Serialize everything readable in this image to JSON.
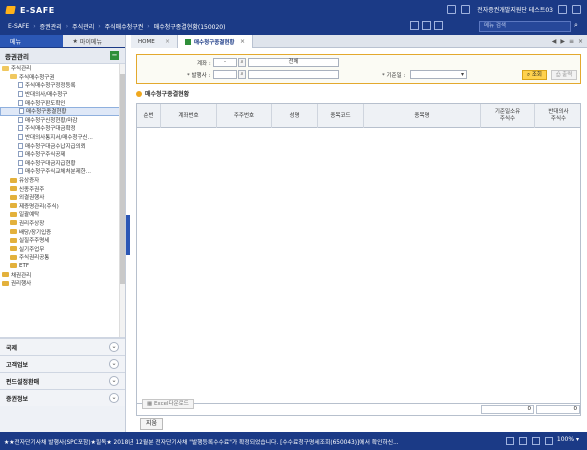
{
  "app": {
    "logo_text": "E-SAFE",
    "user": "전자증권개발지원단 테스트03"
  },
  "breadcrumb": [
    "E-SAFE",
    "증권관리",
    "주식관리",
    "주식매수청구권",
    "매수청구종결현황(150020)"
  ],
  "header": {
    "search_placeholder": "메뉴 검색"
  },
  "left_panel": {
    "tabs": [
      {
        "label": "메뉴"
      },
      {
        "label": "마이메뉴"
      }
    ],
    "section": "증권관리",
    "tree": [
      {
        "label": "주식관리",
        "type": "folder-open",
        "level": 1
      },
      {
        "label": "주식매수청구권",
        "type": "folder-open",
        "level": 2
      },
      {
        "label": "주식매수청구정정등록",
        "type": "doc",
        "level": 3
      },
      {
        "label": "반대의사/매수청구",
        "type": "doc",
        "level": 3
      },
      {
        "label": "매수청구판도확인",
        "type": "doc",
        "level": 3
      },
      {
        "label": "매수청구종결현황",
        "type": "doc",
        "level": 3,
        "selected": true
      },
      {
        "label": "매수청구신청현황/마감",
        "type": "doc",
        "level": 3
      },
      {
        "label": "주식매수청구대금확정",
        "type": "doc",
        "level": 3
      },
      {
        "label": "반대의사통지서/매수청구신...",
        "type": "doc",
        "level": 3
      },
      {
        "label": "매수청구대금수납지급의뢰",
        "type": "doc",
        "level": 3
      },
      {
        "label": "매수청구주식공제",
        "type": "doc",
        "level": 3
      },
      {
        "label": "매수청구대금지급현황",
        "type": "doc",
        "level": 3
      },
      {
        "label": "매수청구주식교체처분제한...",
        "type": "doc",
        "level": 3
      },
      {
        "label": "유상증자",
        "type": "folder",
        "level": 2
      },
      {
        "label": "신종주권주",
        "type": "folder",
        "level": 2
      },
      {
        "label": "외결권행사",
        "type": "folder",
        "level": 2
      },
      {
        "label": "제증명관리(주식)",
        "type": "folder",
        "level": 2
      },
      {
        "label": "일괄예탁",
        "type": "folder",
        "level": 2
      },
      {
        "label": "권리주상장",
        "type": "folder",
        "level": 2
      },
      {
        "label": "배당/장기입증",
        "type": "folder",
        "level": 2
      },
      {
        "label": "실질주주명세",
        "type": "folder",
        "level": 2
      },
      {
        "label": "실기주업무",
        "type": "folder",
        "level": 2
      },
      {
        "label": "주식권리공통",
        "type": "folder",
        "level": 2
      },
      {
        "label": "ETF",
        "type": "folder",
        "level": 2
      },
      {
        "label": "채권관리",
        "type": "folder",
        "level": 1
      },
      {
        "label": "권리행사",
        "type": "folder",
        "level": 1
      }
    ],
    "sections": [
      {
        "label": "국제"
      },
      {
        "label": "고객업보"
      },
      {
        "label": "펀드설정환매"
      },
      {
        "label": "증권정보"
      }
    ]
  },
  "tabs": [
    {
      "label": "HOME"
    },
    {
      "label": "매수청구종결현황"
    }
  ],
  "filters": {
    "account_label": "계좌 :",
    "account_value": "-",
    "account_name": "전체",
    "issuer_label": "* 발행사 :",
    "date_label": "* 기준일 :",
    "search_button": "조회",
    "print_button": "출력"
  },
  "section_title": "매수청구종결현황",
  "grid": {
    "columns": [
      "순번",
      "계좌번호",
      "주주번호",
      "성명",
      "종목코드",
      "종목명",
      "기준일소유\n주식수",
      "반대의사\n주식수"
    ],
    "footer": [
      "0",
      "0"
    ]
  },
  "buttons": {
    "excel": "Excel다운로드",
    "close": "지움"
  },
  "statusbar": {
    "ticker": "★★전자단기사채 발행사(SPC포함)★필독★ 2018년 12월분 전자단기사채 \"발행등록수수료\"가 확정되었습니다. [수수료청구명세조회(650043)]에서 확인하신...",
    "zoom": "100%"
  }
}
